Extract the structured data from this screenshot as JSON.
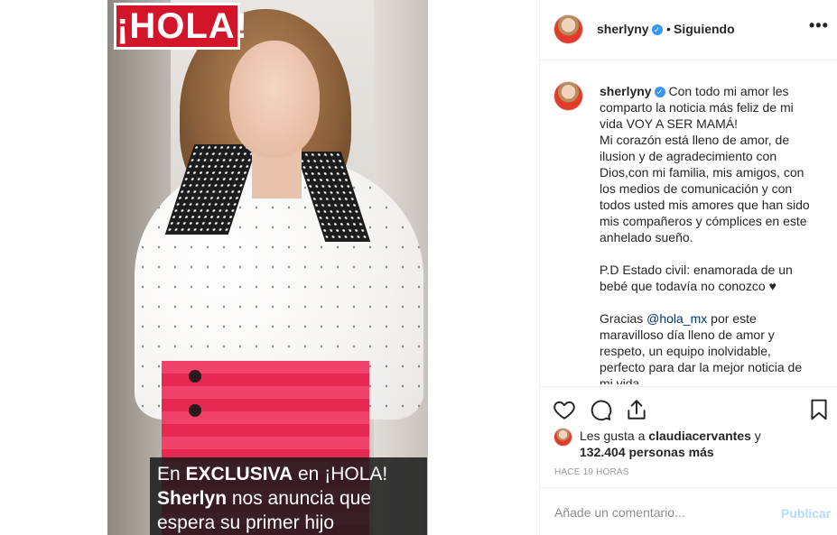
{
  "image": {
    "logo_text": "¡HOLA!",
    "caption": {
      "line1_prefix": "En ",
      "line1_bold": "EXCLUSIVA",
      "line1_suffix": " en ¡HOLA!",
      "line2_bold": "Sherlyn",
      "line2_rest": " nos anuncia que",
      "line3": "espera su primer hijo"
    }
  },
  "header": {
    "username": "sherlyny",
    "separator": "•",
    "follow_status": "Siguiendo",
    "more": "•••"
  },
  "post": {
    "username": "sherlyny",
    "caption_lines": [
      "Con todo mi amor les comparto la noticia más feliz de mi vida VOY A SER MAMÁ!",
      "Mi corazón está lleno de amor, de ilusion y de agradecimiento con Dios,con mi familia, mis amigos, con los medios de comunicación y con todos usted mis amores que han sido mis compañeros y cómplices en este anhelado sueño."
    ],
    "pd": "P.D Estado civil: enamorada de un bebé que todavía no conozco ♥",
    "thanks_prefix": "Gracias ",
    "thanks_mention": "@hola_mx",
    "thanks_rest": " por este maravilloso día lleno de amor y respeto, un equipo inolvidable, perfecto para dar la mejor noticia de mi vida"
  },
  "likes": {
    "prefix": "Les gusta a ",
    "user": "claudiacervantes",
    "conj": " y",
    "count": "132.404 personas más"
  },
  "timestamp": "HACE 19 HORAS",
  "comment": {
    "placeholder": "Añade un comentario...",
    "publish": "Publicar"
  },
  "colors": {
    "verified": "#3897f0",
    "mention": "#003569",
    "publish_disabled": "#b3dbff",
    "hola_red": "#d3152a"
  },
  "icons": [
    "heart-icon",
    "comment-icon",
    "share-icon",
    "bookmark-icon",
    "verified-icon"
  ]
}
